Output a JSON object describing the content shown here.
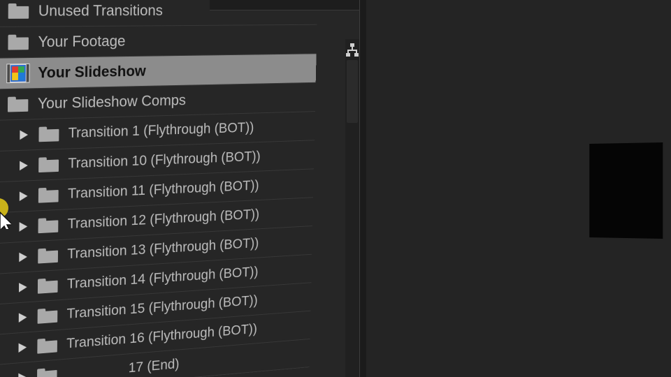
{
  "project": {
    "items": [
      {
        "type": "folder",
        "label": "Unused Transitions"
      },
      {
        "type": "folder",
        "label": "Your Footage"
      },
      {
        "type": "composition",
        "label": "Your Slideshow",
        "selected": true
      },
      {
        "type": "folder",
        "label": "Your Slideshow Comps"
      }
    ],
    "children": [
      "Transition 1 (Flythrough (BOT))",
      "Transition 10 (Flythrough (BOT))",
      "Transition 11 (Flythrough (BOT))",
      "Transition 12 (Flythrough (BOT))",
      "Transition 13 (Flythrough (BOT))",
      "Transition 14 (Flythrough (BOT))",
      "Transition 15 (Flythrough (BOT))",
      "Transition 16 (Flythrough (BOT))",
      "17 (End)"
    ]
  },
  "colors": {
    "panel_bg": "#262626",
    "selection": "#8c8c8c",
    "text": "#bcbcbc",
    "cursor_highlight": "#c9b21a"
  },
  "icons": {
    "folder": "folder-icon",
    "composition": "composition-icon",
    "twirl": "twirl-right-icon",
    "flowchart": "flowchart-icon",
    "cursor": "mouse-pointer-icon"
  }
}
